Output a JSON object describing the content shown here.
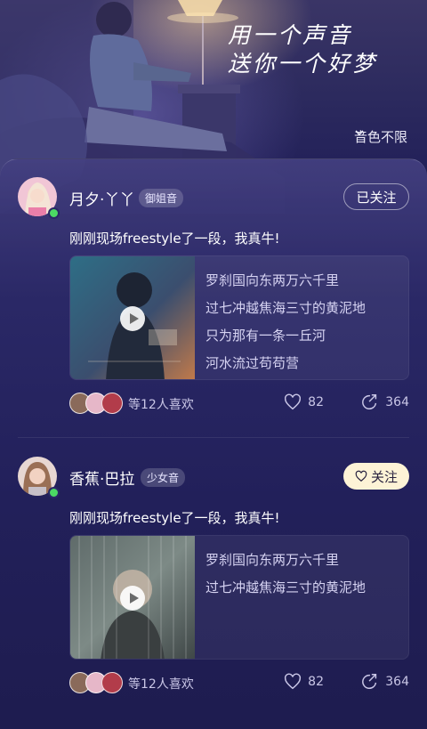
{
  "hero": {
    "slogan_line1": "用一个声音",
    "slogan_line2": "送你一个好梦",
    "filter_label": "音色不限"
  },
  "posts": [
    {
      "name": "月夕·丫丫",
      "tag": "御姐音",
      "follow_label": "已关注",
      "followed": true,
      "online": true,
      "text": "刚刚现场freestyle了一段，我真牛!",
      "lyrics": [
        "罗刹国向东两万六千里",
        "过七冲越焦海三寸的黄泥地",
        "只为那有一条一丘河",
        "河水流过苟苟营"
      ],
      "likes_text": "等12人喜欢",
      "like_count": "82",
      "share_count": "364"
    },
    {
      "name": "香蕉·巴拉",
      "tag": "少女音",
      "follow_label": "关注",
      "followed": false,
      "online": true,
      "text": "刚刚现场freestyle了一段，我真牛!",
      "lyrics": [
        "罗刹国向东两万六千里",
        "过七冲越焦海三寸的黄泥地"
      ],
      "likes_text": "等12人喜欢",
      "like_count": "82",
      "share_count": "364"
    }
  ],
  "colors": {
    "background": "#1e1c4a",
    "follow_button_bg": "#fdf3d6",
    "online_dot": "#4cd964"
  }
}
